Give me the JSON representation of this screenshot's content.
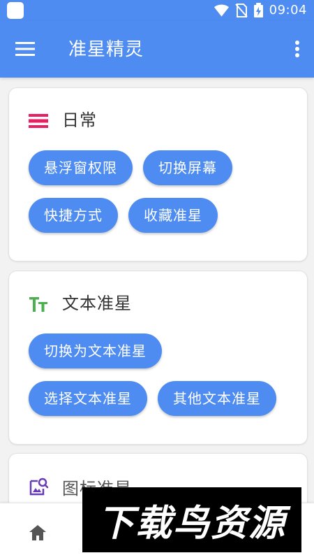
{
  "status_bar": {
    "time": "09:04",
    "icons": [
      "wifi-icon",
      "no-sim-icon",
      "battery-charging-icon"
    ]
  },
  "app_bar": {
    "title": "准星精灵",
    "menu_icon": "hamburger-menu-icon",
    "more_icon": "more-vert-icon"
  },
  "sections": [
    {
      "title": "日常",
      "icon": "list-icon",
      "icon_color": "#e91e63",
      "buttons": [
        "悬浮窗权限",
        "切换屏幕",
        "快捷方式",
        "收藏准星"
      ]
    },
    {
      "title": "文本准星",
      "icon": "text-size-icon",
      "icon_color": "#4caf50",
      "buttons": [
        "切换为文本准星",
        "选择文本准星",
        "其他文本准星"
      ]
    },
    {
      "title": "图标准星",
      "icon": "image-search-icon",
      "icon_color": "#673ab7",
      "buttons": []
    }
  ],
  "bottom_nav": {
    "home_icon": "home-icon"
  },
  "watermark": {
    "text": "下载鸟资源"
  },
  "colors": {
    "primary": "#4e8cf1",
    "background": "#f2f2f2",
    "card": "#ffffff"
  }
}
